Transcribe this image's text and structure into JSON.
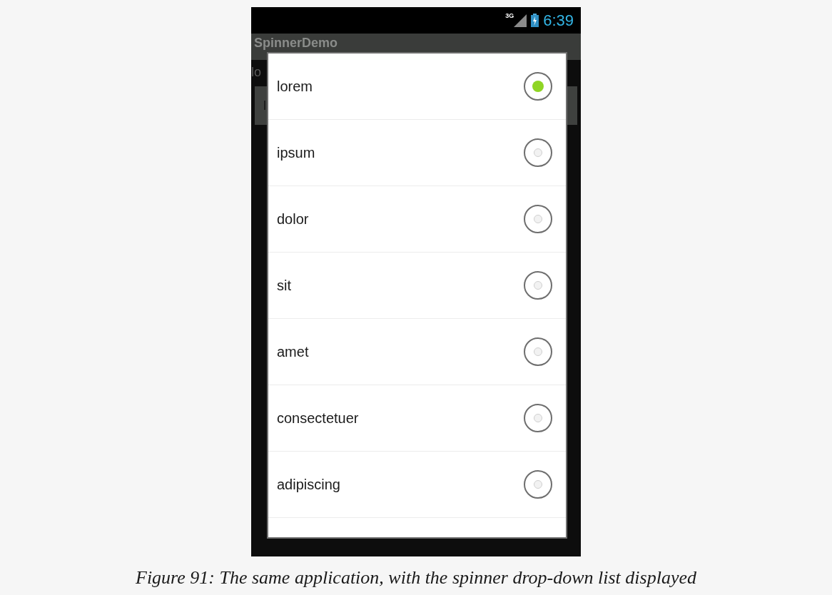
{
  "status_bar": {
    "network": "3G",
    "time": "6:39"
  },
  "action_bar": {
    "title": "SpinnerDemo"
  },
  "background": {
    "label": "lo",
    "spinner_value": "l"
  },
  "dialog": {
    "items": [
      {
        "label": "lorem",
        "selected": true
      },
      {
        "label": "ipsum",
        "selected": false
      },
      {
        "label": "dolor",
        "selected": false
      },
      {
        "label": "sit",
        "selected": false
      },
      {
        "label": "amet",
        "selected": false
      },
      {
        "label": "consectetuer",
        "selected": false
      },
      {
        "label": "adipiscing",
        "selected": false
      }
    ]
  },
  "caption": "Figure 91: The same application, with the spinner drop-down list displayed"
}
